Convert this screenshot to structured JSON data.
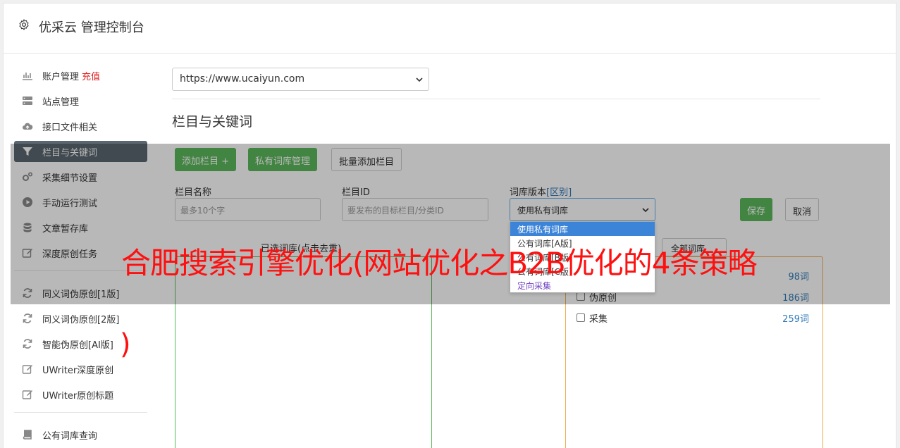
{
  "header": {
    "title": "优采云 管理控制台",
    "icon": "gear-icon"
  },
  "sidebar": {
    "items": [
      {
        "label": "账户管理",
        "extra": "充值",
        "icon": "bar-chart-icon"
      },
      {
        "label": "站点管理",
        "icon": "server-icon"
      },
      {
        "label": "接口文件相关",
        "icon": "cloud-upload-icon"
      },
      {
        "label": "栏目与关键词",
        "icon": "filter-icon",
        "active": true
      },
      {
        "label": "采集细节设置",
        "icon": "gears-icon"
      },
      {
        "label": "手动运行测试",
        "icon": "play-circle-icon"
      },
      {
        "label": "文章暂存库",
        "icon": "database-icon"
      },
      {
        "label": "深度原创任务",
        "icon": "edit-icon"
      },
      {
        "label": "同义词伪原创[1版]",
        "icon": "refresh-icon"
      },
      {
        "label": "同义词伪原创[2版]",
        "icon": "refresh-icon"
      },
      {
        "label": "智能伪原创[AI版]",
        "icon": "refresh-icon"
      },
      {
        "label": "UWriter深度原创",
        "icon": "edit-icon"
      },
      {
        "label": "UWriter原创标题",
        "icon": "edit-icon"
      },
      {
        "label": "公有词库查询",
        "icon": "book-icon"
      }
    ]
  },
  "main": {
    "site_select": "https://www.ucaiyun.com",
    "section_title": "栏目与关键词",
    "buttons": {
      "add_column": "添加栏目 +",
      "private_lib": "私有词库管理",
      "batch_add": "批量添加栏目",
      "save": "保存",
      "cancel": "取消"
    },
    "fields": {
      "column_name_label": "栏目名称",
      "column_name_placeholder": "最多10个字",
      "column_id_label": "栏目ID",
      "column_id_placeholder": "要发布的目标栏目/分类ID",
      "lib_version_label": "词库版本",
      "lib_version_link": "[区别]",
      "lib_version_value": "使用私有词库"
    },
    "dropdown_options": [
      {
        "label": "使用私有词库",
        "selected": true
      },
      {
        "label": "公有词库[A版]"
      },
      {
        "label": "公有词库[B版]"
      },
      {
        "label": "公有词库[C版]"
      },
      {
        "label": "定向采集",
        "purple": true
      }
    ],
    "selected_lib_header": "已选词库(点击去重)",
    "lib_filter": "全部词库",
    "libraries": [
      {
        "name": "",
        "count": "98词"
      },
      {
        "name": "伪原创",
        "count": "186词"
      },
      {
        "name": "采集",
        "count": "259词"
      }
    ]
  },
  "overlay_text": {
    "headline": "合肥搜索引擎优化(网站优化之B2B优化的4条策略",
    "tail": ")"
  },
  "colors": {
    "green": "#5cb85c",
    "active_nav": "#5b6770",
    "watermark": "#ff1010",
    "link": "#337ab7"
  }
}
